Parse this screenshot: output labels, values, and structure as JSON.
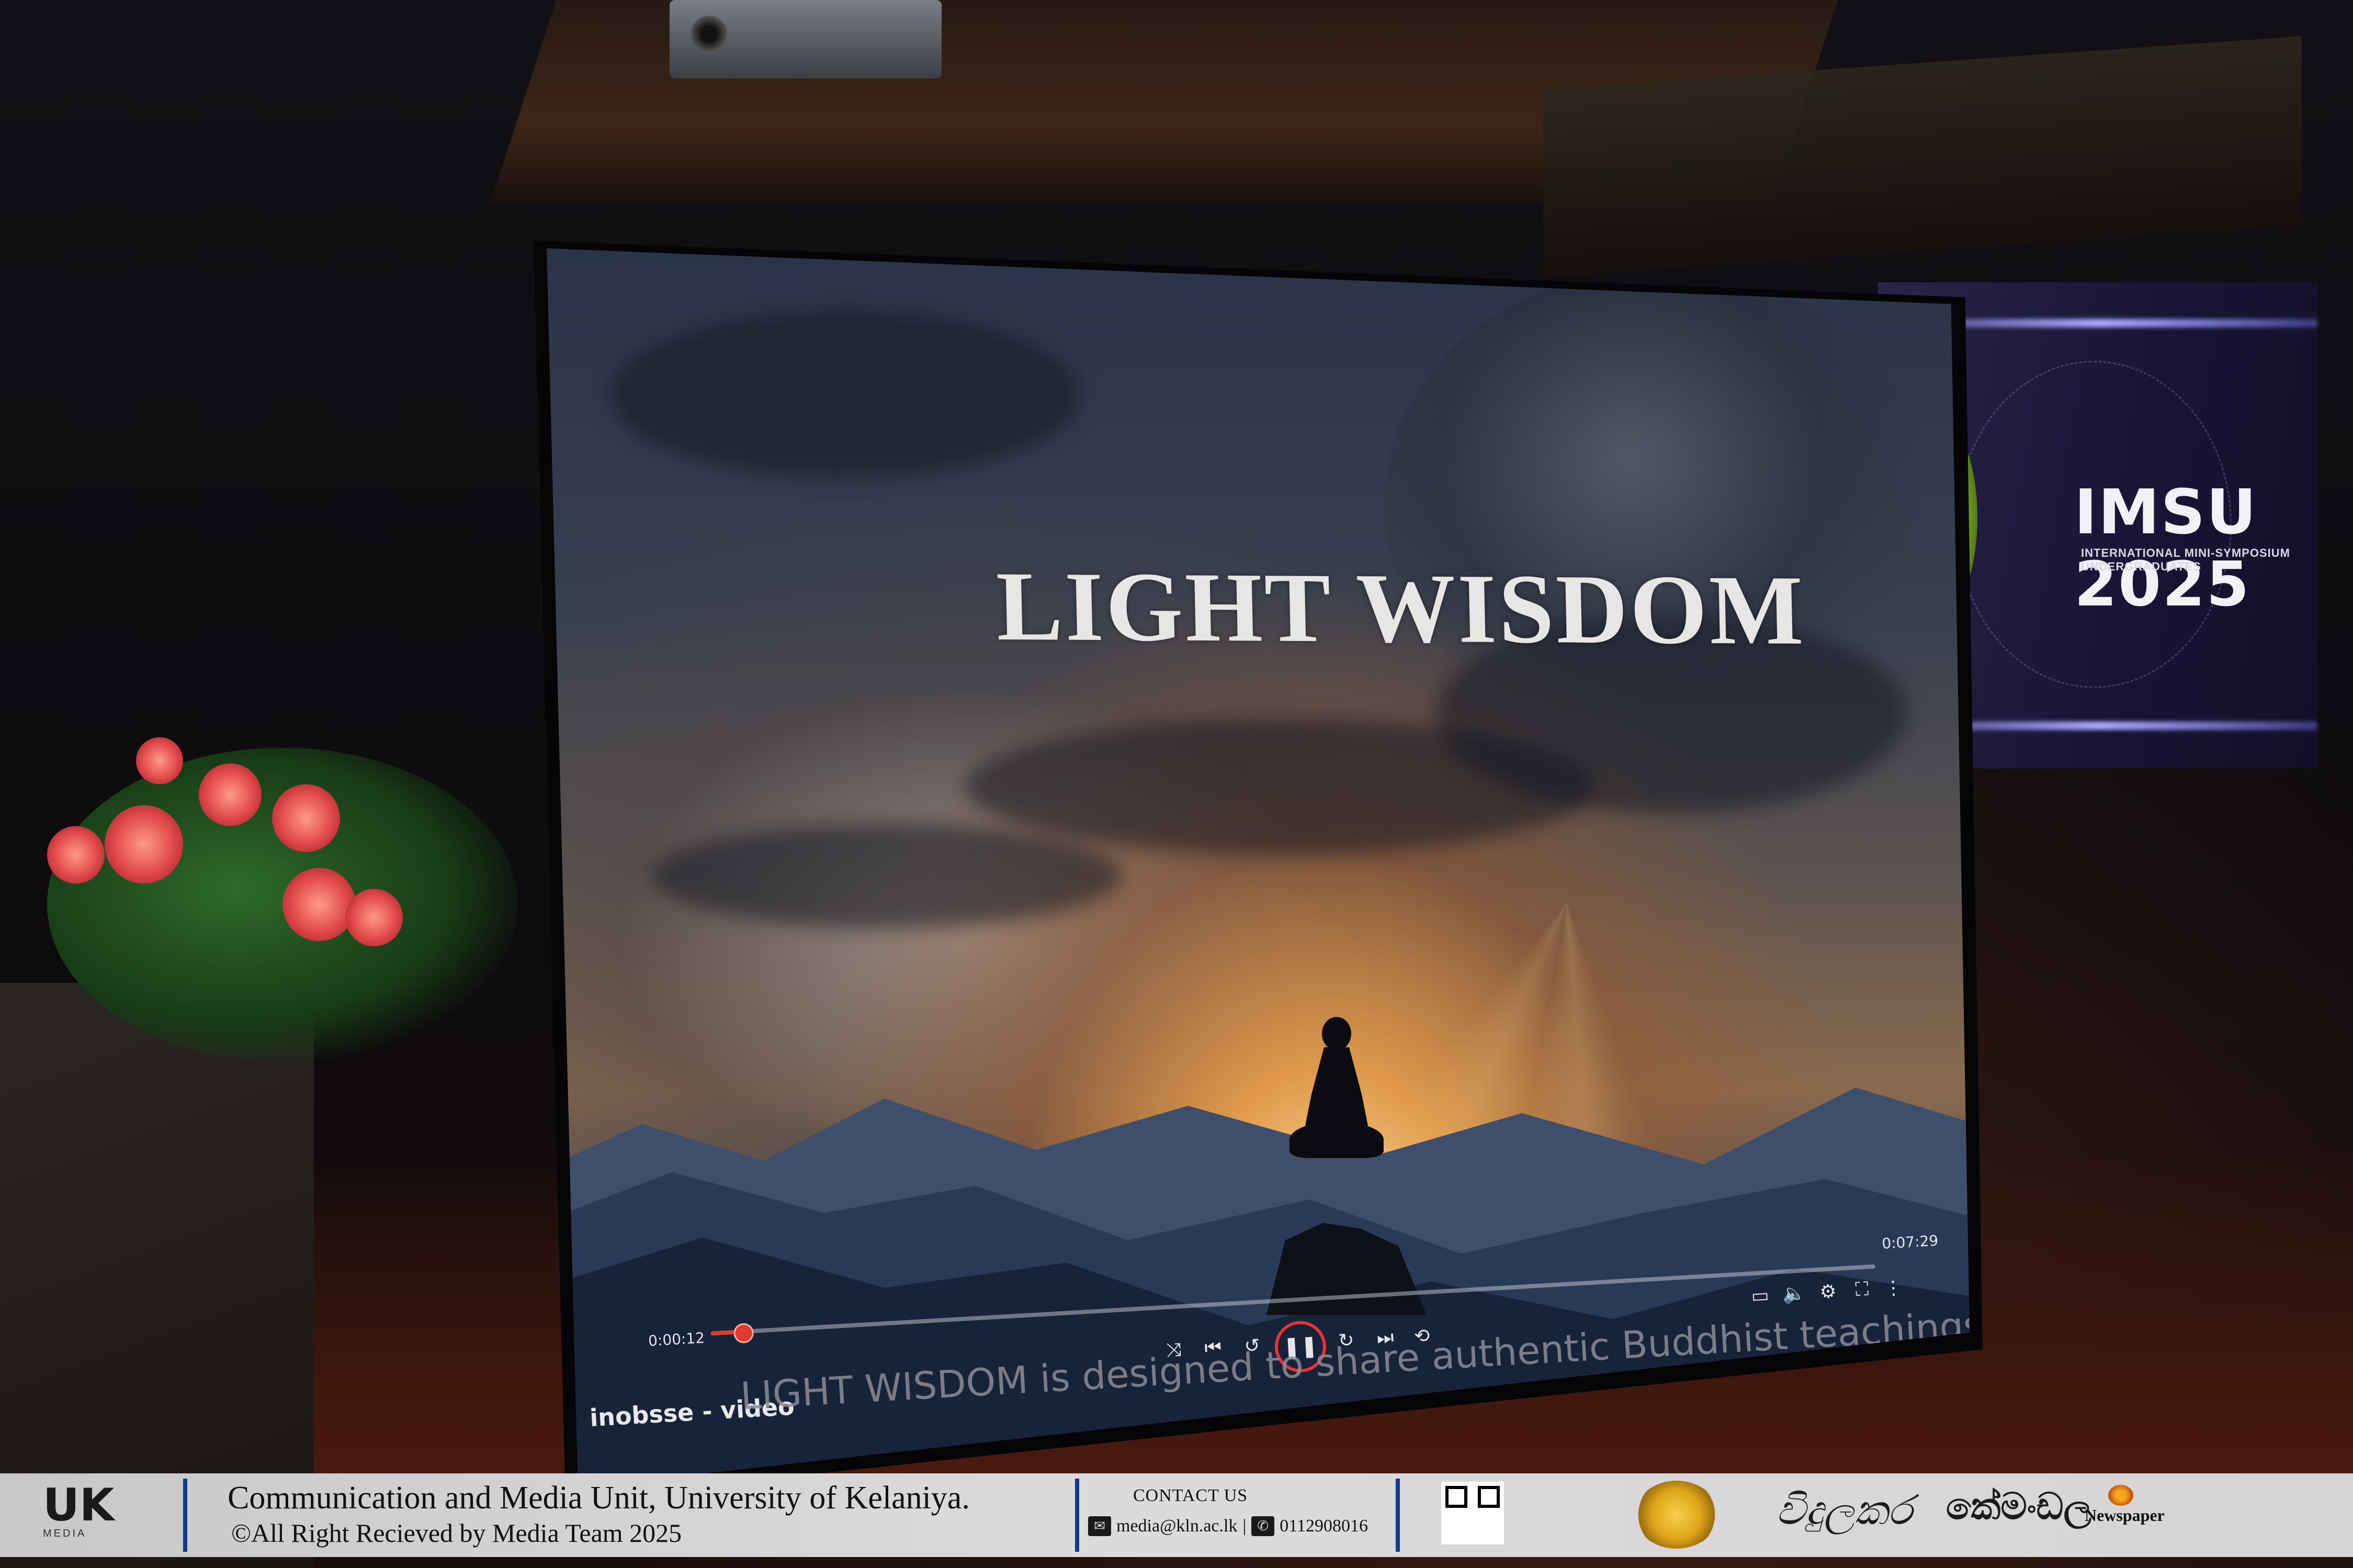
{
  "video": {
    "title": "LIGHT WISDOM",
    "current_time": "0:00:12",
    "total_time": "0:07:29",
    "progress": 0.027,
    "channel": "inobsse - video",
    "caption": "LIGHT WISDOM is designed to share authentic Buddhist teachings globally",
    "accent_color": "#e23a2d",
    "controls": [
      "shuffle-icon",
      "previous-icon",
      "rewind-icon",
      "pause-icon",
      "forward-icon",
      "next-icon",
      "repeat-icon"
    ],
    "right_controls": [
      "subtitles-icon",
      "volume-icon",
      "settings-icon",
      "fullscreen-icon",
      "more-icon"
    ]
  },
  "projection": {
    "title": "IMSU 2025",
    "subtitle": "INTERNATIONAL MINI-SYMPOSIUM UNDERGRADUATES"
  },
  "banner": {
    "logo_text": "UK",
    "logo_sub": "MEDIA",
    "org": "Communication and Media Unit, University of Kelaniya.",
    "rights": "©All Right Recieved by Media Team 2025",
    "contact_heading": "CONTACT US",
    "email": "media@kln.ac.lk",
    "separator": "|",
    "phone": "0112908016",
    "publication_1": "විදුලකර",
    "publication_2": "කේමංඩල",
    "newspaper": "Newspaper",
    "accent_color": "#143a8a"
  }
}
